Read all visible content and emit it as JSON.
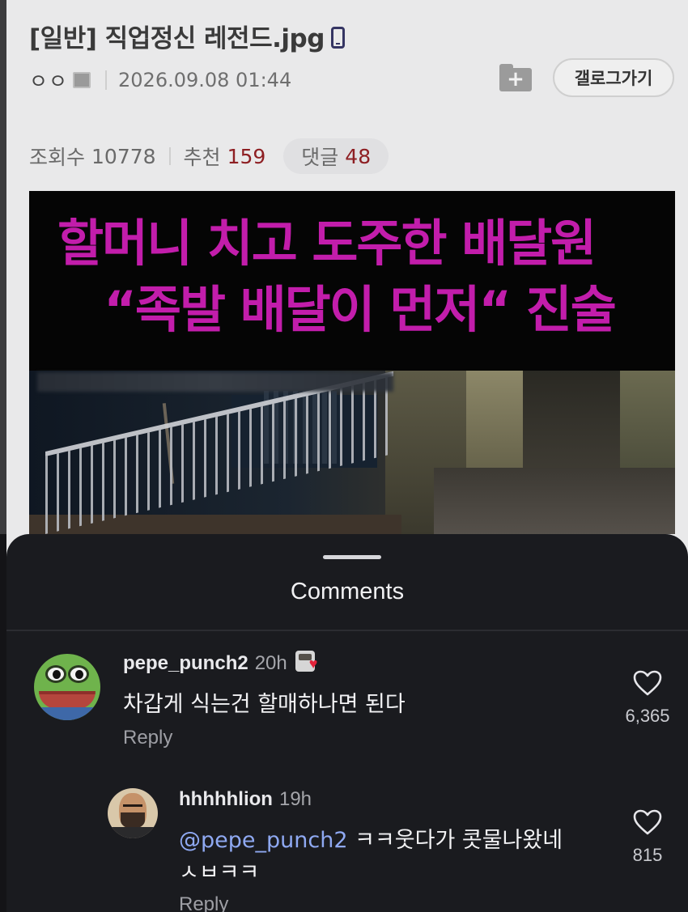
{
  "post": {
    "title": "[일반] 직업정신 레전드.jpg",
    "author": "ㅇㅇ",
    "date": "2026.09.08 01:44",
    "add_icon_glyph": "+",
    "gallog_label": "갤로그가기",
    "stats": {
      "views_label": "조회수",
      "views": "10778",
      "recommend_label": "추천",
      "recommend": "159",
      "comments_label": "댓글",
      "comments": "48"
    }
  },
  "news_image": {
    "headline_line1": "할머니 치고 도주한 배달원",
    "headline_line2": "“족발 배달이 먼저“ 진술",
    "headline_color": "#c21dab"
  },
  "comments_sheet": {
    "title": "Comments",
    "comments": [
      {
        "username": "pepe_punch2",
        "time": "20h",
        "text": "차갑게 식는건 할매하나면 된다",
        "reply_label": "Reply",
        "likes": "6,365"
      },
      {
        "username": "hhhhhlion",
        "time": "19h",
        "mention": "@pepe_punch2",
        "text_line1": "ㅋㅋ웃다가 콧물나왔네",
        "text_line2": "ㅅㅂㅋㅋ",
        "reply_label": "Reply",
        "likes": "815"
      }
    ]
  },
  "colors": {
    "accent_red": "#8e1f23",
    "mention_blue": "#8fa9f2",
    "sheet_bg": "#1a1b1f"
  }
}
